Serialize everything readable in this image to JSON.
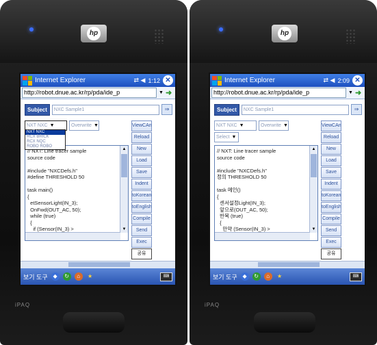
{
  "device": {
    "brand": "iPAQ",
    "logo": "hp"
  },
  "shared": {
    "app_title": "Internet Explorer",
    "url": "http://robot.dnue.ac.kr/rp/pda/ide_p",
    "subject_button": "Subject",
    "subject_value": "NXC Sample1",
    "second_select": "Overwrite",
    "side_buttons": [
      "ViewCAn",
      "Reload",
      "New",
      "Load",
      "Save",
      "Indent",
      "toKorean",
      "toEnglish",
      "Compile",
      "Send",
      "Exec"
    ],
    "menubar_text": "보기 도구"
  },
  "screens": [
    {
      "name": "left",
      "time": "1:12",
      "language_select": "NXT NXC",
      "dropdown_options": [
        "NXT NXC",
        "RCX BRICK",
        "RCX NQC",
        "ROBO ROBO"
      ],
      "selected_option": 0,
      "code_lines": [
        "// NXT: Line tracer sample",
        "source code",
        "",
        "#include \"NXCDefs.h\"",
        "#define THRESHOLD 50",
        "",
        "task main()",
        "{",
        "  etSensorLight(IN_3);",
        "  OnFwd(OUT_AC, 50);",
        "  while (true)",
        "  {",
        "    if (Sensor(IN_3) >"
      ],
      "bottom_button": "공유"
    },
    {
      "name": "right",
      "time": "2:09",
      "language_select": "NXT NXC",
      "extra_select": "Select",
      "code_lines": [
        "// NXT: Line tracer sample",
        "source code",
        "",
        "#include \"NXCDefs.h\"",
        "정의 THRESHOLD 50",
        "",
        "task 메인()",
        "{",
        "  센서설정Light(IN_3);",
        "  앞으로(OUT_AC, 50);",
        "  반복 (true)",
        "  {",
        "    만약 (Sensor(IN_3) >"
      ],
      "bottom_button": "공유"
    }
  ]
}
